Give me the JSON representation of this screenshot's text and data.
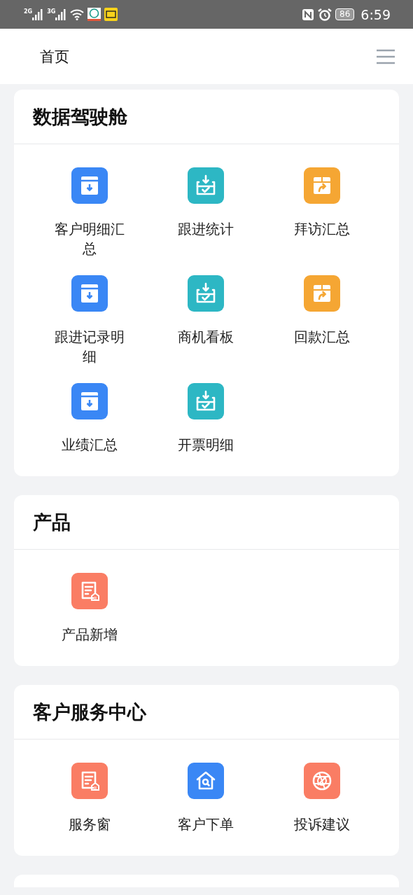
{
  "status_bar": {
    "networks": [
      {
        "label": "2G"
      },
      {
        "label": "3G"
      }
    ],
    "battery": "86",
    "time": "6:59"
  },
  "header": {
    "title": "首页"
  },
  "sections": [
    {
      "title": "数据驾驶舱",
      "items": [
        {
          "label": "客户明细汇总",
          "kind": "inbox",
          "color": "#3a87f5"
        },
        {
          "label": "跟进统计",
          "kind": "tray",
          "color": "#2db7c4"
        },
        {
          "label": "拜访汇总",
          "kind": "package",
          "color": "#f5a633"
        },
        {
          "label": "跟进记录明细",
          "kind": "inbox",
          "color": "#3a87f5"
        },
        {
          "label": "商机看板",
          "kind": "tray",
          "color": "#2db7c4"
        },
        {
          "label": "回款汇总",
          "kind": "package",
          "color": "#f5a633"
        },
        {
          "label": "业绩汇总",
          "kind": "inbox",
          "color": "#3a87f5"
        },
        {
          "label": "开票明细",
          "kind": "tray",
          "color": "#2db7c4"
        }
      ]
    },
    {
      "title": "产品",
      "items": [
        {
          "label": "产品新增",
          "kind": "document",
          "color": "#fa7d64"
        }
      ]
    },
    {
      "title": "客户服务中心",
      "items": [
        {
          "label": "服务窗",
          "kind": "document",
          "color": "#fa7d64"
        },
        {
          "label": "客户下单",
          "kind": "house",
          "color": "#3a87f5"
        },
        {
          "label": "投诉建议",
          "kind": "globe",
          "color": "#fa7d64"
        }
      ]
    },
    {
      "kind": "cut-off"
    }
  ]
}
